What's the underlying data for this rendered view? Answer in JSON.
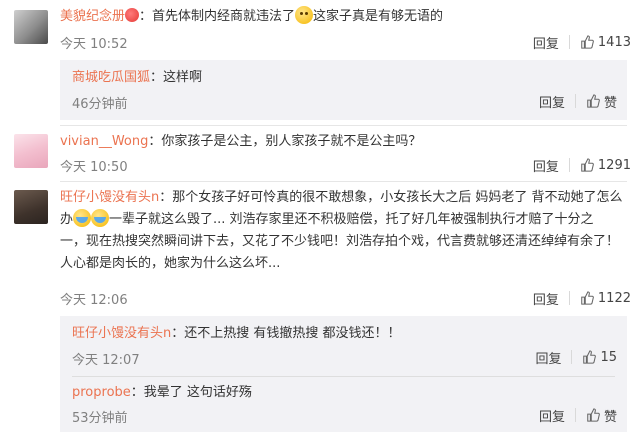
{
  "comments": [
    {
      "user": "美貌纪念册",
      "text_a": "：首先体制内经商就违法了",
      "text_b": "这家子真是有够无语的",
      "time": "今天 10:52",
      "reply_label": "回复",
      "likes": "1413",
      "replies": [
        {
          "user": "商城吃瓜国狐",
          "text": "：这样啊",
          "time": "46分钟前",
          "reply_label": "回复",
          "likes": "赞"
        }
      ]
    },
    {
      "user": "vivian__Wong",
      "text": "：你家孩子是公主，别人家孩子就不是公主吗？",
      "time": "今天 10:50",
      "reply_label": "回复",
      "likes": "1291"
    },
    {
      "user": "旺仔小馒没有头n",
      "line1": "：那个女孩子好可怜真的很不敢想象，小女孩长大之后 妈妈老了 背不动她了怎么",
      "line2_prefix": "办",
      "line2_rest": "一辈子就这么毁了... 刘浩存家里还不积极赔偿，托了好几年被强制执行才赔了十分之",
      "line3": "一，现在热搜突然瞬间讲下去，又花了不少钱吧！刘浩存拍个戏，代言费就够还清还绰绰有余了！",
      "line4": "人心都是肉长的，她家为什么这么坏...",
      "time": "今天 12:06",
      "reply_label": "回复",
      "likes": "1122",
      "replies": [
        {
          "user": "旺仔小馒没有头n",
          "text": "：还不上热搜 有钱撤热搜 都没钱还！！",
          "time": "今天 12:07",
          "reply_label": "回复",
          "likes": "15"
        },
        {
          "user": "proprobe",
          "text": "：我晕了 这句话好殇",
          "time": "53分钟前",
          "reply_label": "回复",
          "likes": "赞"
        }
      ]
    }
  ]
}
